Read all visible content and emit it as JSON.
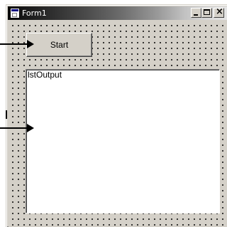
{
  "window": {
    "title": "Form1",
    "controls": {
      "minimize_icon": "minimize-icon",
      "maximize_icon": "maximize-icon",
      "close_icon": "close-icon",
      "close_glyph": "×"
    }
  },
  "form": {
    "start_button_label": "Start",
    "listbox": {
      "name_text": "lstOutput",
      "items": []
    }
  },
  "annotations": {
    "arrow_icons": [
      "arrow-right-icon",
      "arrow-right-icon"
    ]
  },
  "colors": {
    "face": "#d4d0c8",
    "list_bg": "#ffffff",
    "text": "#000000"
  }
}
